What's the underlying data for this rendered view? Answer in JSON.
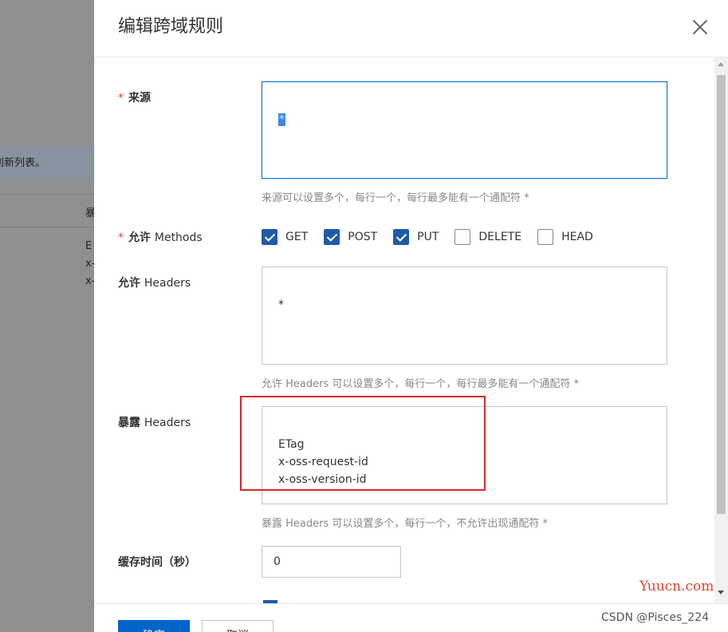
{
  "background": {
    "notice_text": "刷新列表。",
    "table_header": "暴",
    "table_cells": [
      "E",
      "x-",
      "x-"
    ]
  },
  "drawer": {
    "title": "编辑跨域规则",
    "fields": {
      "origin": {
        "label": "来源",
        "value": "*",
        "help": "来源可以设置多个，每行一个，每行最多能有一个通配符 *"
      },
      "methods": {
        "label_cn": "允许",
        "label_en": "Methods",
        "options": [
          {
            "label": "GET",
            "checked": true
          },
          {
            "label": "POST",
            "checked": true
          },
          {
            "label": "PUT",
            "checked": true
          },
          {
            "label": "DELETE",
            "checked": false
          },
          {
            "label": "HEAD",
            "checked": false
          }
        ]
      },
      "allow_headers": {
        "label_cn": "允许",
        "label_en": "Headers",
        "value": "*",
        "help": "允许 Headers 可以设置多个，每行一个，每行最多能有一个通配符 *"
      },
      "expose_headers": {
        "label_cn": "暴露",
        "label_en": "Headers",
        "value": "ETag\nx-oss-request-id\nx-oss-version-id",
        "help": "暴露 Headers 可以设置多个，每行一个，不允许出现通配符 *"
      },
      "cache_time": {
        "label": "缓存时间（秒）",
        "value": "0"
      }
    },
    "footer": {
      "confirm_label": "确定",
      "cancel_label": "取消"
    }
  },
  "watermarks": {
    "site": "Yuucn.com",
    "author": "CSDN @Pisces_224"
  },
  "colors": {
    "primary": "#0064c8",
    "checkbox_checked": "#1e5aa8",
    "required": "#e5412d",
    "highlight_box": "#d8262e",
    "focus_border": "#0070cc"
  }
}
